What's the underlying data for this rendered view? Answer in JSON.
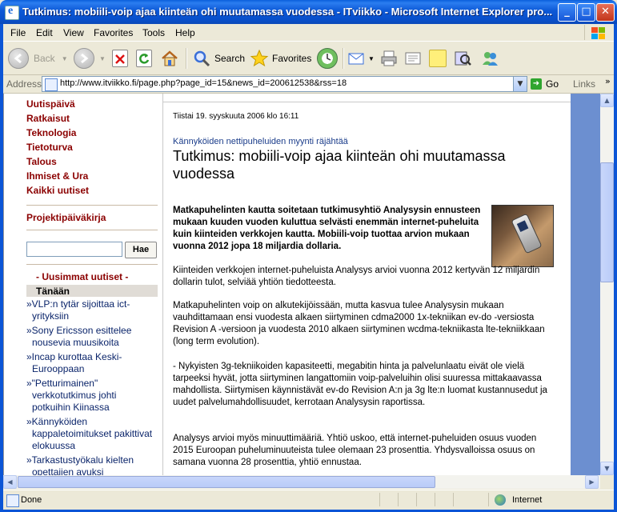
{
  "window": {
    "title": "Tutkimus: mobiili-voip ajaa kiinteän ohi muutamassa vuodessa - ITviikko - Microsoft Internet Explorer pro...",
    "min": "_",
    "max": "□",
    "close": "✕"
  },
  "menu": {
    "file": "File",
    "edit": "Edit",
    "view": "View",
    "favorites": "Favorites",
    "tools": "Tools",
    "help": "Help"
  },
  "toolbar": {
    "back": "Back",
    "search": "Search",
    "favorites": "Favorites"
  },
  "address": {
    "label": "Address",
    "url": "http://www.itviikko.fi/page.php?page_id=15&news_id=200612538&rss=18",
    "go": "Go",
    "links": "Links",
    "links_chevron": "»"
  },
  "sidebar": {
    "nav": [
      "Uutispäivä",
      "Ratkaisut",
      "Teknologia",
      "Tietoturva",
      "Talous",
      "Ihmiset & Ura",
      "Kaikki uutiset"
    ],
    "diary": "Projektipäiväkirja",
    "search_button": "Hae",
    "latest_heading": "- Uusimmat uutiset -",
    "today": "Tänään",
    "news": [
      [
        "»VLP:n tytär sijoittaa ict-",
        "yrityksiin"
      ],
      [
        "»Sony Ericsson esittelee",
        "nousevia muusikoita"
      ],
      [
        "»Incap kurottaa Keski-",
        "Eurooppaan"
      ],
      [
        "»\"Petturimainen\"",
        "verkkotutkimus johti",
        "potkuihin Kiinassa"
      ],
      [
        "»Kännyköiden",
        "kappaletoimitukset pakittivat",
        "elokuussa"
      ],
      [
        "»Tarkastustyökalu kielten",
        "opettajien avuksi"
      ]
    ]
  },
  "article": {
    "date": "Tiistai 19. syyskuuta 2006 klo 16:11",
    "kicker": "Kännyköiden nettipuheluiden myynti räjähtää",
    "headline": "Tutkimus: mobiili-voip ajaa kiinteän ohi muutamassa vuodessa",
    "lead": "Matkapuhelinten kautta soitetaan tutkimusyhtiö Analysysin ennusteen mukaan kuuden vuoden kuluttua selvästi enemmän internet-puheluita kuin kiinteiden verkkojen kautta. Mobiili-voip tuottaa arvion mukaan vuonna 2012 jopa 18 miljardia dollaria.",
    "p1": "Kiinteiden verkkojen internet-puheluista Analysys arvioi vuonna 2012 kertyvän 12 miljardin dollarin tulot, selviää yhtiön tiedotteesta.",
    "p2": "Matkapuhelinten voip on alkutekijöissään, mutta kasvua tulee Analysysin mukaan vauhdittamaan ensi vuodesta alkaen siirtyminen cdma2000 1x-tekniikan ev-do -versiosta Revision A -versioon ja vuodesta 2010 alkaen siirtyminen wcdma-tekniikasta lte-tekniikkaan (long term evolution).",
    "p3": "- Nykyisten 3g-tekniikoiden kapasiteetti, megabitin hinta ja palvelunlaatu eivät ole vielä tarpeeksi hyvät, jotta siirtyminen langattomiin voip-palveluihin olisi suuressa mittakaavassa mahdollista. Siirtymisen käynnistävät ev-do Revision A:n ja 3g lte:n luomat kustannusedut ja uudet palvelumahdollisuudet, kerrotaan Analysysin raportissa.",
    "p4": "Analysys arvioi myös minuuttimääriä. Yhtiö uskoo, että internet-puheluiden osuus vuoden 2015 Euroopan puheluminuuteista tulee olemaan 23 prosenttia. Yhdysvalloissa osuus on samana vuonna 28 prosenttia, yhtiö ennustaa."
  },
  "status": {
    "text": "Done",
    "zone": "Internet"
  },
  "colors": {
    "nav_link": "#8B0000",
    "news_link": "#0A246A",
    "right_strip": "#6C8FD0"
  }
}
